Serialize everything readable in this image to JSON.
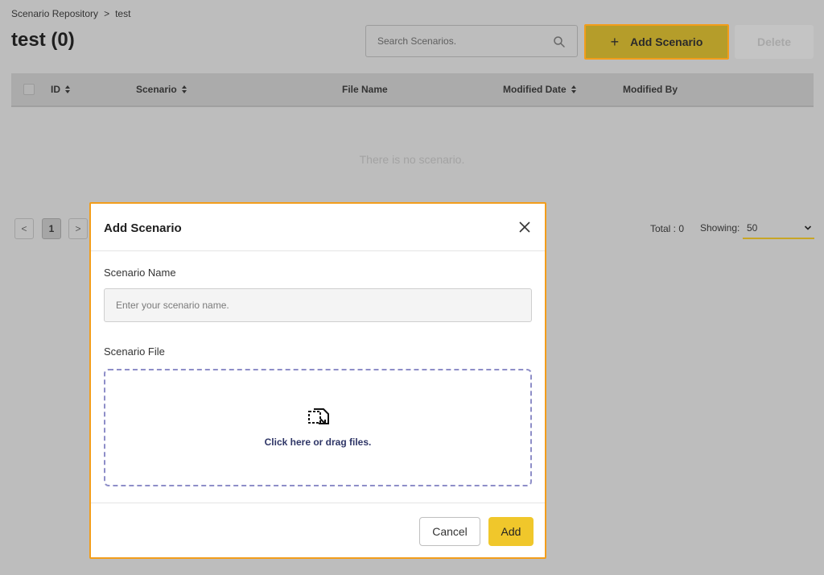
{
  "breadcrumb": {
    "root": "Scenario Repository",
    "separator": ">",
    "current": "test"
  },
  "page_title": "test (0)",
  "search": {
    "placeholder": "Search Scenarios.",
    "icon": "search-icon"
  },
  "toolbar": {
    "add_icon": "+",
    "add_label": "Add Scenario",
    "delete_label": "Delete"
  },
  "table": {
    "columns": {
      "id": "ID",
      "scenario": "Scenario",
      "file_name": "File Name",
      "modified_date": "Modified Date",
      "modified_by": "Modified By"
    },
    "empty_message": "There is no scenario."
  },
  "pagination": {
    "prev": "<",
    "current": "1",
    "next": ">"
  },
  "summary": {
    "total": "Total : 0",
    "showing_label": "Showing:",
    "showing_value": "50"
  },
  "modal": {
    "title": "Add Scenario",
    "name_label": "Scenario Name",
    "name_placeholder": "Enter your scenario name.",
    "file_label": "Scenario File",
    "dropzone_text": "Click here or drag files.",
    "cancel_label": "Cancel",
    "add_label": "Add"
  },
  "colors": {
    "accent": "#f0c72b",
    "highlight_border": "#f29d1b",
    "dropzone_border": "#8e8ec8",
    "overlay": "#bdbdbd"
  }
}
